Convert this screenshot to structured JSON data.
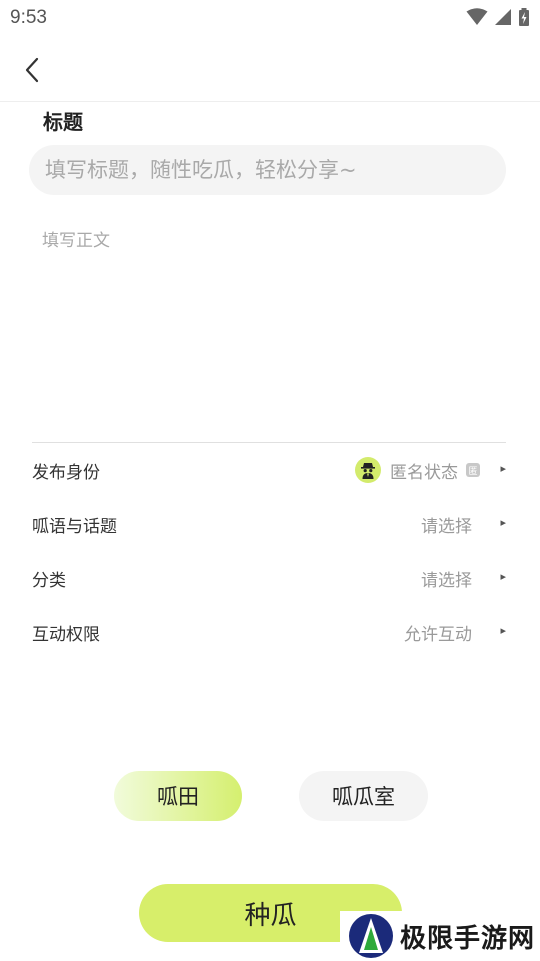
{
  "status_bar": {
    "time": "9:53",
    "icons": [
      "wifi-icon",
      "signal-icon",
      "battery-charging-icon"
    ]
  },
  "header": {
    "back_icon": "chevron-left-icon"
  },
  "form": {
    "title_label": "标题",
    "title_placeholder": "填写标题，随性吃瓜，轻松分享~",
    "body_placeholder": "填写正文"
  },
  "options": [
    {
      "label": "发布身份",
      "value": "匿名状态",
      "badge": "匿"
    },
    {
      "label": "呱语与话题",
      "value": "请选择"
    },
    {
      "label": "分类",
      "value": "请选择"
    },
    {
      "label": "互动权限",
      "value": "允许互动"
    }
  ],
  "arrow_glyph": "▸",
  "channels": {
    "field": "呱田",
    "room": "呱瓜室"
  },
  "submit_label": "种瓜",
  "watermark": {
    "text": "极限手游网"
  },
  "colors": {
    "accent": "#d7ee6a",
    "accent_light": "#f1fbdb",
    "input_bg": "#f4f4f4"
  }
}
